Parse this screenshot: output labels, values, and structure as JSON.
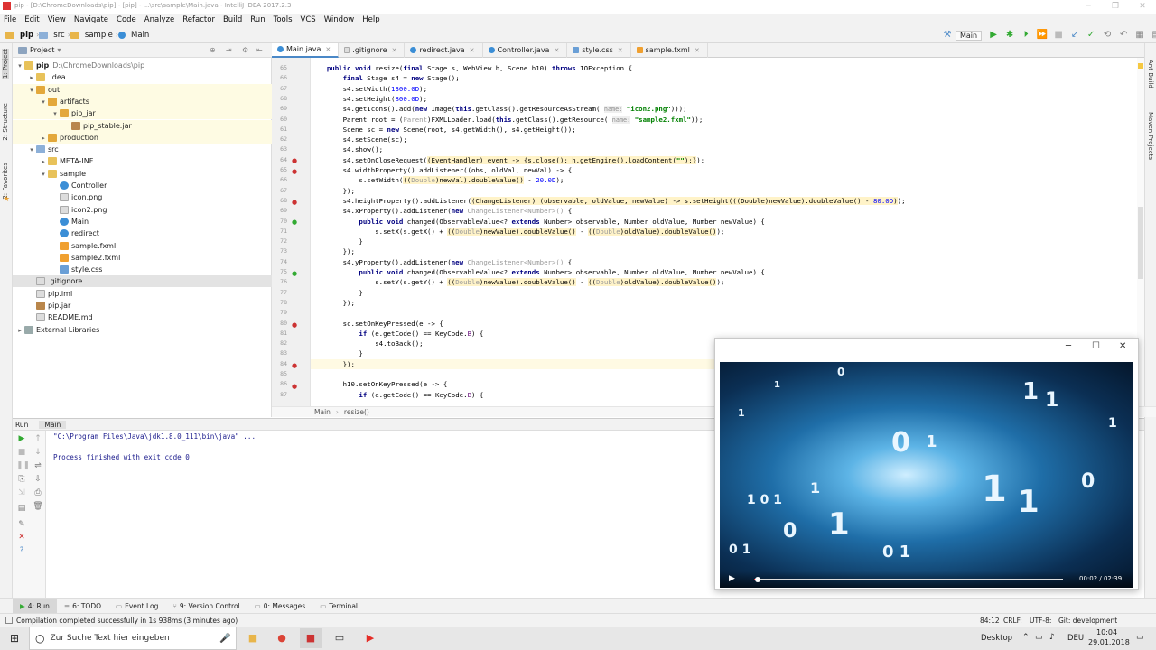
{
  "window": {
    "title": "pip - [D:\\ChromeDownloads\\pip] - [pip] - ...\\src\\sample\\Main.java - IntelliJ IDEA 2017.2.3"
  },
  "menu": [
    "File",
    "Edit",
    "View",
    "Navigate",
    "Code",
    "Analyze",
    "Refactor",
    "Build",
    "Run",
    "Tools",
    "VCS",
    "Window",
    "Help"
  ],
  "breadcrumbs": [
    "pip",
    "src",
    "sample",
    "Main"
  ],
  "run_config": "Main",
  "left_tool_labels": [
    "1: Project",
    "2: Structure",
    "2: Favorites"
  ],
  "right_tool_labels": [
    "Ant Build",
    "Maven Projects"
  ],
  "project_panel": {
    "title": "Project"
  },
  "tree": [
    {
      "label": "pip",
      "path": "D:\\ChromeDownloads\\pip",
      "depth": 0,
      "icon": "folder-icon",
      "arrow": "▾"
    },
    {
      "label": ".idea",
      "depth": 1,
      "icon": "folder-icon",
      "arrow": "▸"
    },
    {
      "label": "out",
      "depth": 1,
      "icon": "ofolder-icon",
      "arrow": "▾"
    },
    {
      "label": "artifacts",
      "depth": 2,
      "icon": "ofolder-icon",
      "arrow": "▾"
    },
    {
      "label": "pip_jar",
      "depth": 3,
      "icon": "ofolder-icon",
      "arrow": "▾"
    },
    {
      "label": "pip_stable.jar",
      "depth": 4,
      "icon": "jar-icon",
      "arrow": ""
    },
    {
      "label": "production",
      "depth": 2,
      "icon": "ofolder-icon",
      "arrow": "▸"
    },
    {
      "label": "src",
      "depth": 1,
      "icon": "src-icon",
      "arrow": "▾"
    },
    {
      "label": "META-INF",
      "depth": 2,
      "icon": "folder-icon",
      "arrow": "▸"
    },
    {
      "label": "sample",
      "depth": 2,
      "icon": "folder-icon",
      "arrow": "▾"
    },
    {
      "label": "Controller",
      "depth": 3,
      "icon": "class-icon",
      "arrow": ""
    },
    {
      "label": "icon.png",
      "depth": 3,
      "icon": "image-icon",
      "arrow": ""
    },
    {
      "label": "icon2.png",
      "depth": 3,
      "icon": "image-icon",
      "arrow": ""
    },
    {
      "label": "Main",
      "depth": 3,
      "icon": "class-icon",
      "arrow": ""
    },
    {
      "label": "redirect",
      "depth": 3,
      "icon": "class-icon",
      "arrow": ""
    },
    {
      "label": "sample.fxml",
      "depth": 3,
      "icon": "xml-icon",
      "arrow": ""
    },
    {
      "label": "sample2.fxml",
      "depth": 3,
      "icon": "xml-icon",
      "arrow": ""
    },
    {
      "label": "style.css",
      "depth": 3,
      "icon": "css-icon",
      "arrow": ""
    },
    {
      "label": ".gitignore",
      "depth": 1,
      "icon": "file-icon",
      "arrow": ""
    },
    {
      "label": "pip.iml",
      "depth": 1,
      "icon": "file-icon",
      "arrow": ""
    },
    {
      "label": "pip.jar",
      "depth": 1,
      "icon": "jar-icon",
      "arrow": ""
    },
    {
      "label": "README.md",
      "depth": 1,
      "icon": "file-icon",
      "arrow": ""
    },
    {
      "label": "External Libraries",
      "depth": 0,
      "icon": "library-icon",
      "arrow": "▸"
    }
  ],
  "tabs": [
    {
      "label": "Main.java",
      "active": true
    },
    {
      "label": ".gitignore",
      "active": false
    },
    {
      "label": "redirect.java",
      "active": false
    },
    {
      "label": "Controller.java",
      "active": false
    },
    {
      "label": "style.css",
      "active": false
    },
    {
      "label": "sample.fxml",
      "active": false
    }
  ],
  "line_numbers": [
    "65",
    "66",
    "67",
    "68",
    "69",
    "60",
    "61",
    "62",
    "63",
    "64",
    "65",
    "66",
    "67",
    "68",
    "69",
    "70",
    "71",
    "72",
    "73",
    "74",
    "75",
    "76",
    "77",
    "78",
    "79",
    "80",
    "81",
    "82",
    "83",
    "84",
    "85",
    "86",
    "87"
  ],
  "editor_breadcrumb": [
    "Main",
    "resize()"
  ],
  "run_panel": {
    "label": "Run",
    "config": "Main"
  },
  "console": [
    "\"C:\\Program Files\\Java\\jdk1.8.0_111\\bin\\java\" ...",
    "Process finished with exit code 0"
  ],
  "bottom_tools": [
    {
      "label": "4: Run",
      "active": true
    },
    {
      "label": "6: TODO",
      "active": false
    },
    {
      "label": "Event Log",
      "active": false
    },
    {
      "label": "9: Version Control",
      "active": false
    },
    {
      "label": "0: Messages",
      "active": false
    },
    {
      "label": "Terminal",
      "active": false
    }
  ],
  "status": {
    "message": "Compilation completed successfully in 1s 938ms (3 minutes ago)",
    "position": "84:12",
    "line_sep": "CRLF:",
    "encoding": "UTF-8:",
    "git": "Git: development"
  },
  "taskbar": {
    "search_placeholder": "Zur Suche Text hier eingeben",
    "desktop": "Desktop",
    "lang": "DEU",
    "time": "10:04",
    "date": "29.01.2018"
  },
  "pip_player": {
    "time": "00:02 / 02:39",
    "progress": 0.013
  },
  "colors": {
    "accent": "#4a88c7",
    "keyword": "#000080",
    "string": "#008000",
    "number": "#0000ff"
  }
}
